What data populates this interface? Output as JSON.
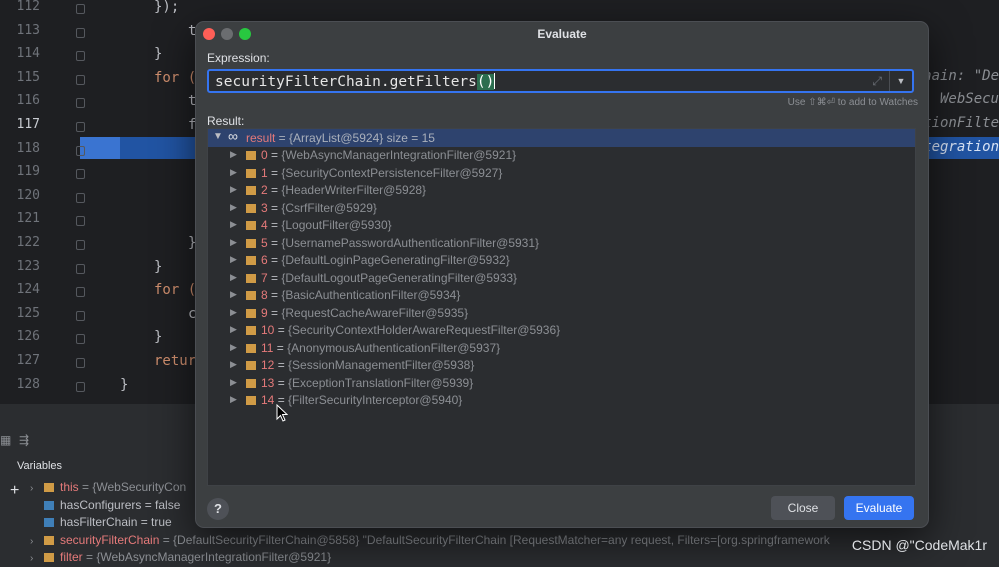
{
  "editor": {
    "line_numbers": [
      "112",
      "113",
      "114",
      "115",
      "116",
      "117",
      "118",
      "119",
      "120",
      "121",
      "122",
      "123",
      "124",
      "125",
      "126",
      "127",
      "128"
    ],
    "current_line": "117",
    "code_lines": [
      {
        "text": "});",
        "indent": 2
      },
      {
        "text": "t",
        "indent": 3
      },
      {
        "text": "}",
        "indent": 2
      },
      {
        "text": "for (",
        "indent": 2,
        "kw": true
      },
      {
        "text": "t",
        "indent": 3
      },
      {
        "text": "f",
        "indent": 3
      },
      {
        "text": "",
        "indent": 0
      },
      {
        "text": "",
        "indent": 0
      },
      {
        "text": "",
        "indent": 0
      },
      {
        "text": "",
        "indent": 0
      },
      {
        "text": "}",
        "indent": 3
      },
      {
        "text": "}",
        "indent": 2
      },
      {
        "text": "for (",
        "indent": 2,
        "kw": true
      },
      {
        "text": "c",
        "indent": 3
      },
      {
        "text": "}",
        "indent": 2
      },
      {
        "text": "retur",
        "indent": 2,
        "kw": true
      },
      {
        "text": "}",
        "indent": 1
      }
    ],
    "right_hints": [
      "hain: \"De",
      "WebSecu",
      "tionFilte",
      "tegration"
    ]
  },
  "debug_panel": {
    "title": "Variables",
    "variables": [
      {
        "arrow": "›",
        "name": "this",
        "value": " = {WebSecurityCon",
        "icon": "orange"
      },
      {
        "arrow": "",
        "name": "hasConfigurers",
        "value": " = false",
        "icon": "blue"
      },
      {
        "arrow": "",
        "name": "hasFilterChain",
        "value": " = true",
        "icon": "blue"
      },
      {
        "arrow": "›",
        "name": "securityFilterChain",
        "value": " = {DefaultSecurityFilterChain@5858} \"DefaultSecurityFilterChain [RequestMatcher=any request, Filters=[org.springframework",
        "icon": "orange"
      },
      {
        "arrow": "›",
        "name": "filter",
        "value": " = {WebAsyncManagerIntegrationFilter@5921}",
        "icon": "orange"
      }
    ]
  },
  "dialog": {
    "title": "Evaluate",
    "expression_label": "Expression:",
    "expression_before_parens": "securityFilterChain.getFilters",
    "expression_parens": "()",
    "watches_hint": "Use ⇧⌘⏎ to add to Watches",
    "result_label": "Result:",
    "result": {
      "name": "result",
      "value": " = {ArrayList@5924}  size = 15"
    },
    "items": [
      {
        "index": "0",
        "value": "{WebAsyncManagerIntegrationFilter@5921}"
      },
      {
        "index": "1",
        "value": "{SecurityContextPersistenceFilter@5927}"
      },
      {
        "index": "2",
        "value": "{HeaderWriterFilter@5928}"
      },
      {
        "index": "3",
        "value": "{CsrfFilter@5929}"
      },
      {
        "index": "4",
        "value": "{LogoutFilter@5930}"
      },
      {
        "index": "5",
        "value": "{UsernamePasswordAuthenticationFilter@5931}"
      },
      {
        "index": "6",
        "value": "{DefaultLoginPageGeneratingFilter@5932}"
      },
      {
        "index": "7",
        "value": "{DefaultLogoutPageGeneratingFilter@5933}"
      },
      {
        "index": "8",
        "value": "{BasicAuthenticationFilter@5934}"
      },
      {
        "index": "9",
        "value": "{RequestCacheAwareFilter@5935}"
      },
      {
        "index": "10",
        "value": "{SecurityContextHolderAwareRequestFilter@5936}"
      },
      {
        "index": "11",
        "value": "{AnonymousAuthenticationFilter@5937}"
      },
      {
        "index": "12",
        "value": "{SessionManagementFilter@5938}"
      },
      {
        "index": "13",
        "value": "{ExceptionTranslationFilter@5939}"
      },
      {
        "index": "14",
        "value": "{FilterSecurityInterceptor@5940}"
      }
    ],
    "close_label": "Close",
    "evaluate_label": "Evaluate",
    "help_label": "?"
  },
  "watermark": "CSDN @\"CodeMak1r",
  "colors": {
    "accent": "#3574f0",
    "highlight_row": "#2154a3",
    "close_light": "#ff5f57",
    "min_light": "#6b6d70",
    "max_light": "#28c840"
  }
}
